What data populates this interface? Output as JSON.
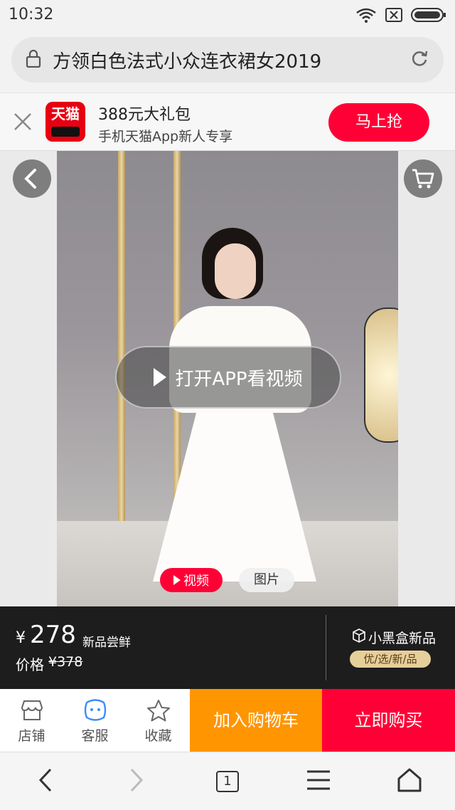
{
  "status_bar": {
    "time": "10:32",
    "icons": [
      "wifi-icon",
      "sim-icon",
      "battery-icon"
    ]
  },
  "url_bar": {
    "title": "方领白色法式小众连衣裙女2019"
  },
  "promo": {
    "logo_text": "天猫",
    "title": "388元大礼包",
    "subtitle": "手机天猫App新人专享",
    "button_label": "马上抢"
  },
  "gallery": {
    "play_label": "打开APP看视频",
    "tab_video": "视频",
    "tab_image": "图片"
  },
  "price": {
    "currency": "¥",
    "current": "278",
    "tag": "新品尝鲜",
    "orig_label": "价格",
    "orig_value": "¥378",
    "blackbox_title": "小黑盒新品",
    "blackbox_badge": "优/选/新/品"
  },
  "actions": {
    "shop": "店铺",
    "service": "客服",
    "favorite": "收藏",
    "add_cart": "加入购物车",
    "buy_now": "立即购买"
  },
  "bottom_nav": {
    "tab_count": "1"
  },
  "colors": {
    "accent": "#ff0036",
    "cart": "#ff9500",
    "price_bg": "#1d1d1d"
  }
}
